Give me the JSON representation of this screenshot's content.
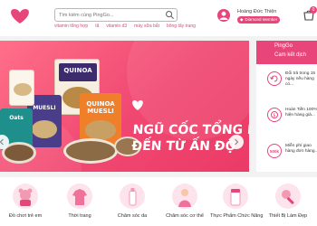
{
  "header": {
    "search_placeholder": "Tìm kiếm cùng PingGo...",
    "quick_links": [
      "vitamin tổng hợp",
      "tã",
      "vitamin d3",
      "máy sữa bắt",
      "bông tẩy trang"
    ],
    "user_name": "Hoàng Đức Thiện",
    "member_label": "Diamond Member",
    "cart_count": "0"
  },
  "banner": {
    "title_line1": "NGŨ CỐC TỔNG HỢP",
    "title_line2": "ĐẾN TỪ ẤN ĐỘ",
    "products": [
      "QUINOA",
      "MUESLI",
      "Oat Flakes",
      "Oats",
      "QUINOA MUESLI"
    ],
    "brand": "healthy me",
    "slide_count": 6,
    "active_slide": 0
  },
  "sidebar": {
    "title_line1": "PingGo",
    "title_line2": "Cam kết dịch",
    "promos": [
      {
        "icon": "return-icon",
        "text": "Đổi trả trong 15 ngày nếu hàng có..."
      },
      {
        "icon": "refund-icon",
        "text": "Hoàn Tiền 100% hiện hàng giả..."
      },
      {
        "icon": "shipping-icon",
        "badge": "500k",
        "text": "Miễn phí giao hàng đơn hàng..."
      }
    ]
  },
  "categories": [
    {
      "name": "Đồ chơi trẻ em",
      "icon": "toys-icon"
    },
    {
      "name": "Thời trang",
      "icon": "fashion-icon"
    },
    {
      "name": "Chăm sóc da",
      "icon": "skincare-icon"
    },
    {
      "name": "Chăm sóc cơ thể",
      "icon": "bodycare-icon"
    },
    {
      "name": "Thực Phẩm Chức Năng",
      "icon": "supplement-icon"
    },
    {
      "name": "Thiết Bị Làm Đẹp",
      "icon": "beauty-device-icon"
    }
  ],
  "colors": {
    "brand": "#e8457a",
    "banner_start": "#ff6f89",
    "banner_end": "#ea3b66"
  }
}
